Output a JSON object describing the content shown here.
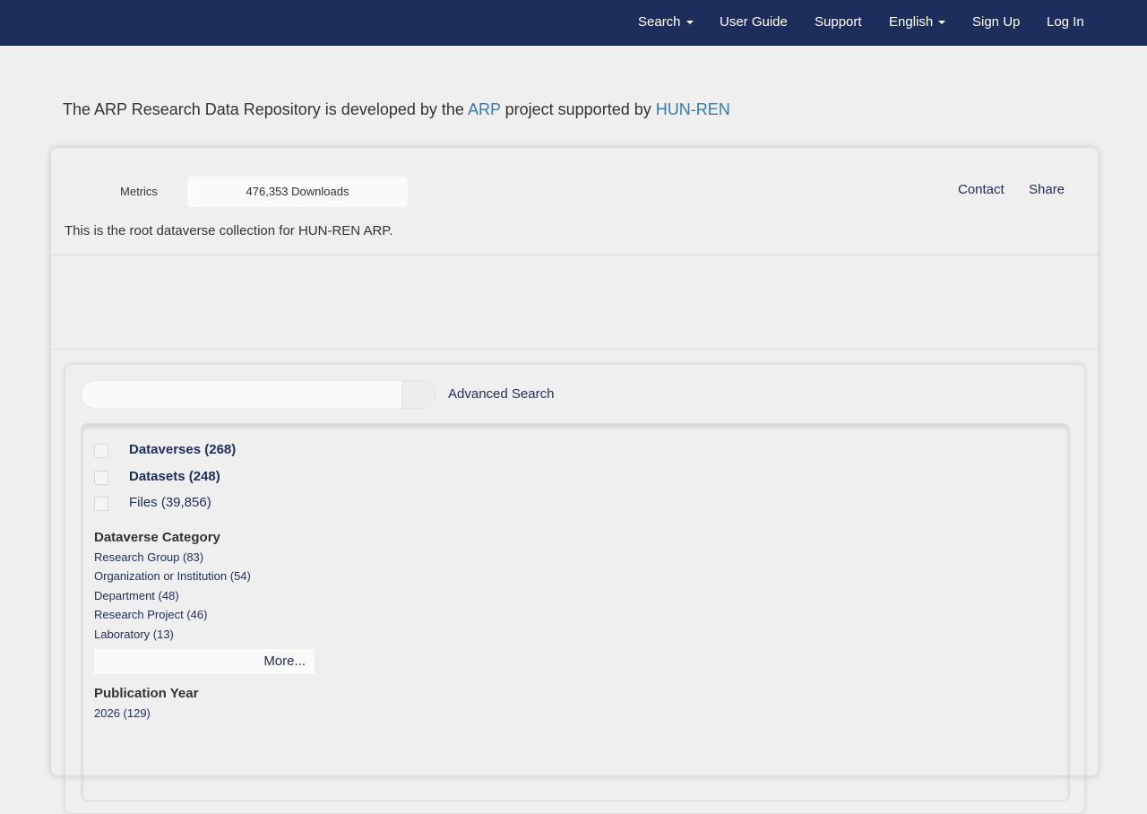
{
  "navbar": {
    "search": "Search",
    "user_guide": "User Guide",
    "support": "Support",
    "language": "English",
    "sign_up": "Sign Up",
    "log_in": "Log In"
  },
  "banner": {
    "prefix": "The ARP Research Data Repository is developed by the ",
    "link1": "ARP",
    "middle": " project supported by ",
    "link2": "HUN-REN"
  },
  "header": {
    "metrics_label": "Metrics",
    "downloads": "476,353 Downloads",
    "contact": "Contact",
    "share": "Share",
    "description": "This is the root dataverse collection for HUN-REN ARP."
  },
  "search": {
    "placeholder": "",
    "advanced": "Advanced Search"
  },
  "types": [
    {
      "label": "Dataverses (268)"
    },
    {
      "label": "Datasets (248)"
    },
    {
      "label": "Files (39,856)"
    }
  ],
  "facets": {
    "category_title": "Dataverse Category",
    "category_items": [
      "Research Group (83)",
      "Organization or Institution (54)",
      "Department (48)",
      "Research Project (46)",
      "Laboratory (13)"
    ],
    "more": "More...",
    "year_title": "Publication Year",
    "year_items": [
      "2026 (129)"
    ]
  },
  "colors": {
    "navbar": "#1d2d5c",
    "link": "#337ab7",
    "facet_link": "#1d2d5c"
  }
}
